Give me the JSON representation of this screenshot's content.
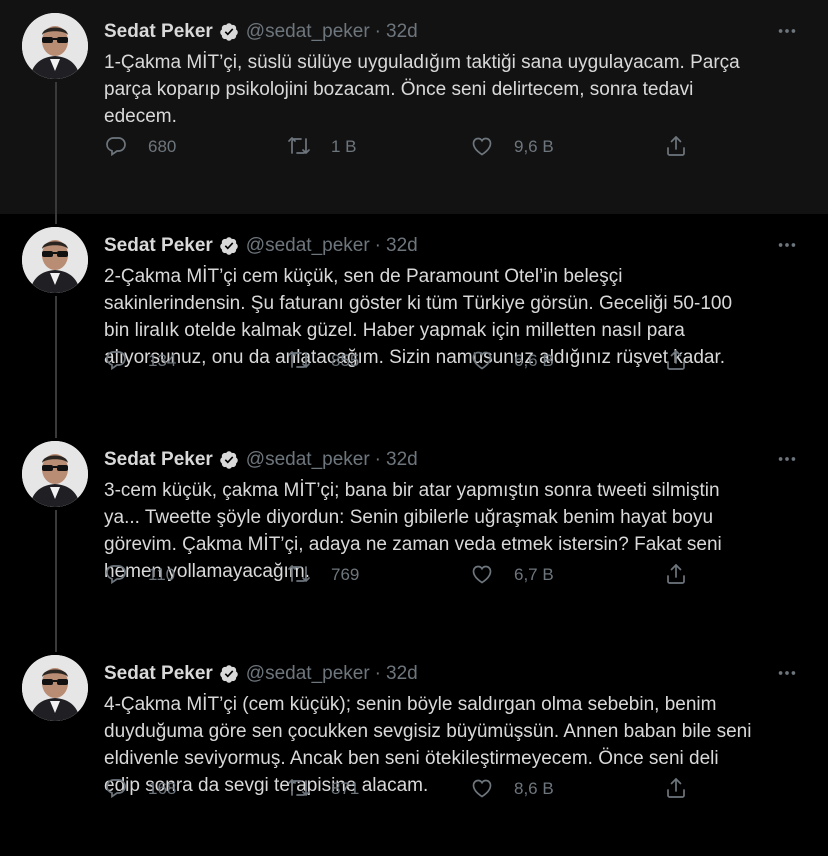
{
  "colors": {
    "background": "#000000",
    "first_tweet_bg": "#121212",
    "text": "#d9d9d9",
    "muted": "#6e767d",
    "verified": "#d9d9d9"
  },
  "icons": {
    "more": "more-horizontal-icon",
    "reply": "reply-icon",
    "retweet": "retweet-icon",
    "like": "heart-icon",
    "share": "share-icon",
    "verified": "verified-badge-icon"
  },
  "tweets": [
    {
      "name": "Sedat Peker",
      "handle": "@sedat_peker",
      "dot": "·",
      "time": "32d",
      "text": "1-Çakma MİT’çi, süslü sülüye uyguladığım taktiği sana uygulayacam. Parça\nparça koparıp psikolojini bozacam. Önce seni delirtecem, sonra tedavi\nedecem.",
      "replies": "680",
      "retweets": "1 B",
      "likes": "9,6 B"
    },
    {
      "name": "Sedat Peker",
      "handle": "@sedat_peker",
      "dot": "·",
      "time": "32d",
      "text": "2-Çakma MİT’çi cem küçük, sen de Paramount Otel’in beleşçi\nsakinlerindensin.  Şu faturanı göster ki tüm Türkiye görsün. Geceliği 50-100\nbin liralık otelde kalmak güzel. Haber yapmak için milletten nasıl para\nalıyorsunuz, onu da anlatacağım. Sizin namusunuz aldığınız rüşvet kadar.",
      "replies": "134",
      "retweets": "855",
      "likes": "6,6 B"
    },
    {
      "name": "Sedat Peker",
      "handle": "@sedat_peker",
      "dot": "·",
      "time": "32d",
      "text": "3-cem küçük, çakma MİT’çi; bana bir atar yapmıştın sonra tweeti silmiştin\nya... Tweette şöyle diyordun: Senin gibilerle uğraşmak benim hayat boyu\ngörevim. Çakma MİT’çi, adaya ne zaman veda etmek istersin? Fakat seni\nhemen yollamayacağım.",
      "replies": "110",
      "retweets": "769",
      "likes": "6,7 B"
    },
    {
      "name": "Sedat Peker",
      "handle": "@sedat_peker",
      "dot": "·",
      "time": "32d",
      "text": "4-Çakma MİT’çi (cem küçük); senin böyle saldırgan olma sebebin, benim\nduyduğuma göre sen çocukken sevgisiz büyümüşsün. Annen baban bile seni\neldivenle seviyormuş. Ancak ben seni ötekileştirmeyecem. Önce seni deli\nedip sonra da sevgi terapisine alacam.",
      "replies": "168",
      "retweets": "871",
      "likes": "8,6 B"
    }
  ]
}
